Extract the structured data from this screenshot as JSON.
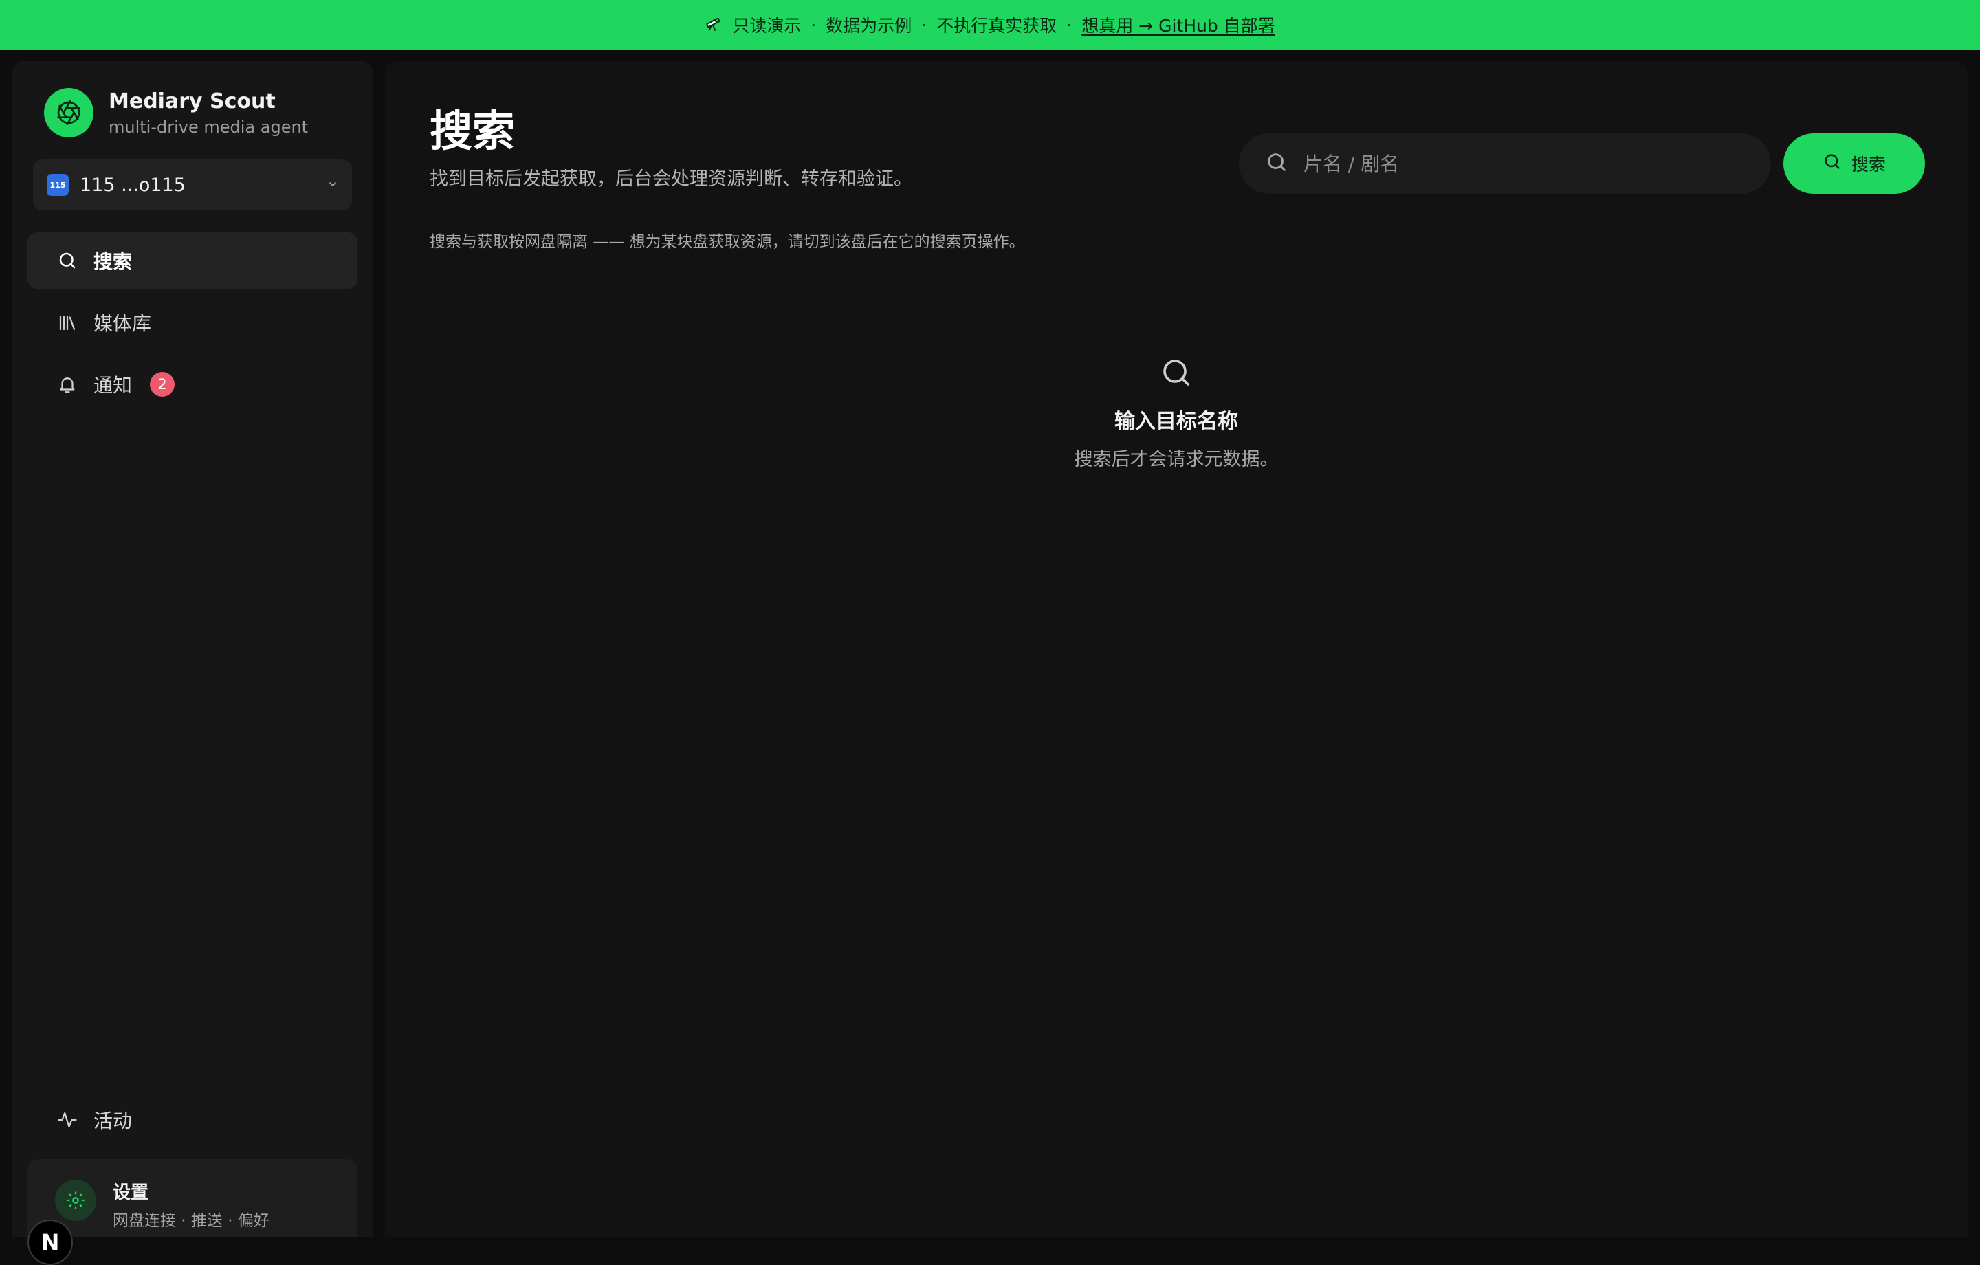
{
  "banner": {
    "icon": "telescope-icon",
    "text_1": "只读演示",
    "sep": "·",
    "text_2": "数据为示例",
    "text_3": "不执行真实获取",
    "link": "想真用 → GitHub 自部署",
    "bg_color": "#1fd65f"
  },
  "brand": {
    "title": "Mediary Scout",
    "subtitle": "multi-drive media agent"
  },
  "drive": {
    "badge": "115",
    "label": "115 ...o115"
  },
  "nav": {
    "search": "搜索",
    "library": "媒体库",
    "notifications": "通知",
    "notifications_count": "2",
    "activity": "活动"
  },
  "settings": {
    "title": "设置",
    "subtitle": "网盘连接 · 推送 · 偏好"
  },
  "dev_badge": "N",
  "main": {
    "title": "搜索",
    "subtitle": "找到目标后发起获取，后台会处理资源判断、转存和验证。",
    "note": "搜索与获取按网盘隔离 —— 想为某块盘获取资源，请切到该盘后在它的搜索页操作。",
    "search_placeholder": "片名 / 剧名",
    "search_button": "搜索",
    "empty_title": "输入目标名称",
    "empty_subtitle": "搜索后才会请求元数据。"
  },
  "colors": {
    "accent": "#1fd65f",
    "badge": "#ef5a6e",
    "drive_badge": "#2f6ee0"
  }
}
